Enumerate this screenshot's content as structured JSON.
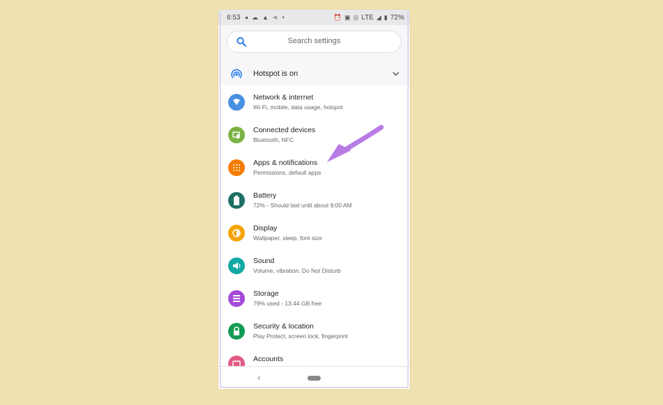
{
  "status_bar": {
    "time": "6:53",
    "network": "LTE",
    "battery": "72%"
  },
  "search": {
    "placeholder": "Search settings"
  },
  "hotspot": {
    "label": "Hotspot is on"
  },
  "settings": [
    {
      "title": "Network & internet",
      "subtitle": "Wi-Fi, mobile, data usage, hotspot",
      "icon": "wifi-icon",
      "color": "#4a90e2"
    },
    {
      "title": "Connected devices",
      "subtitle": "Bluetooth, NFC",
      "icon": "devices-icon",
      "color": "#7cb342"
    },
    {
      "title": "Apps & notifications",
      "subtitle": "Permissions, default apps",
      "icon": "apps-grid-icon",
      "color": "#f57c00"
    },
    {
      "title": "Battery",
      "subtitle": "72% - Should last until about 9:00 AM",
      "icon": "battery-icon",
      "color": "#1f6f66"
    },
    {
      "title": "Display",
      "subtitle": "Wallpaper, sleep, font size",
      "icon": "display-brightness-icon",
      "color": "#f4a300"
    },
    {
      "title": "Sound",
      "subtitle": "Volume, vibration, Do Not Disturb",
      "icon": "volume-icon",
      "color": "#11a9a3"
    },
    {
      "title": "Storage",
      "subtitle": "79% used - 13.44 GB free",
      "icon": "storage-icon",
      "color": "#a64ad8"
    },
    {
      "title": "Security & location",
      "subtitle": "Play Protect, screen lock, fingerprint",
      "icon": "lock-icon",
      "color": "#129b54"
    },
    {
      "title": "Accounts",
      "subtitle": "",
      "icon": "accounts-icon",
      "color": "#e25b84"
    }
  ],
  "nav": {
    "back_symbol": "‹"
  },
  "colors": {
    "page_background": "#f0e2b0",
    "annotation_arrow": "#b77be6"
  }
}
